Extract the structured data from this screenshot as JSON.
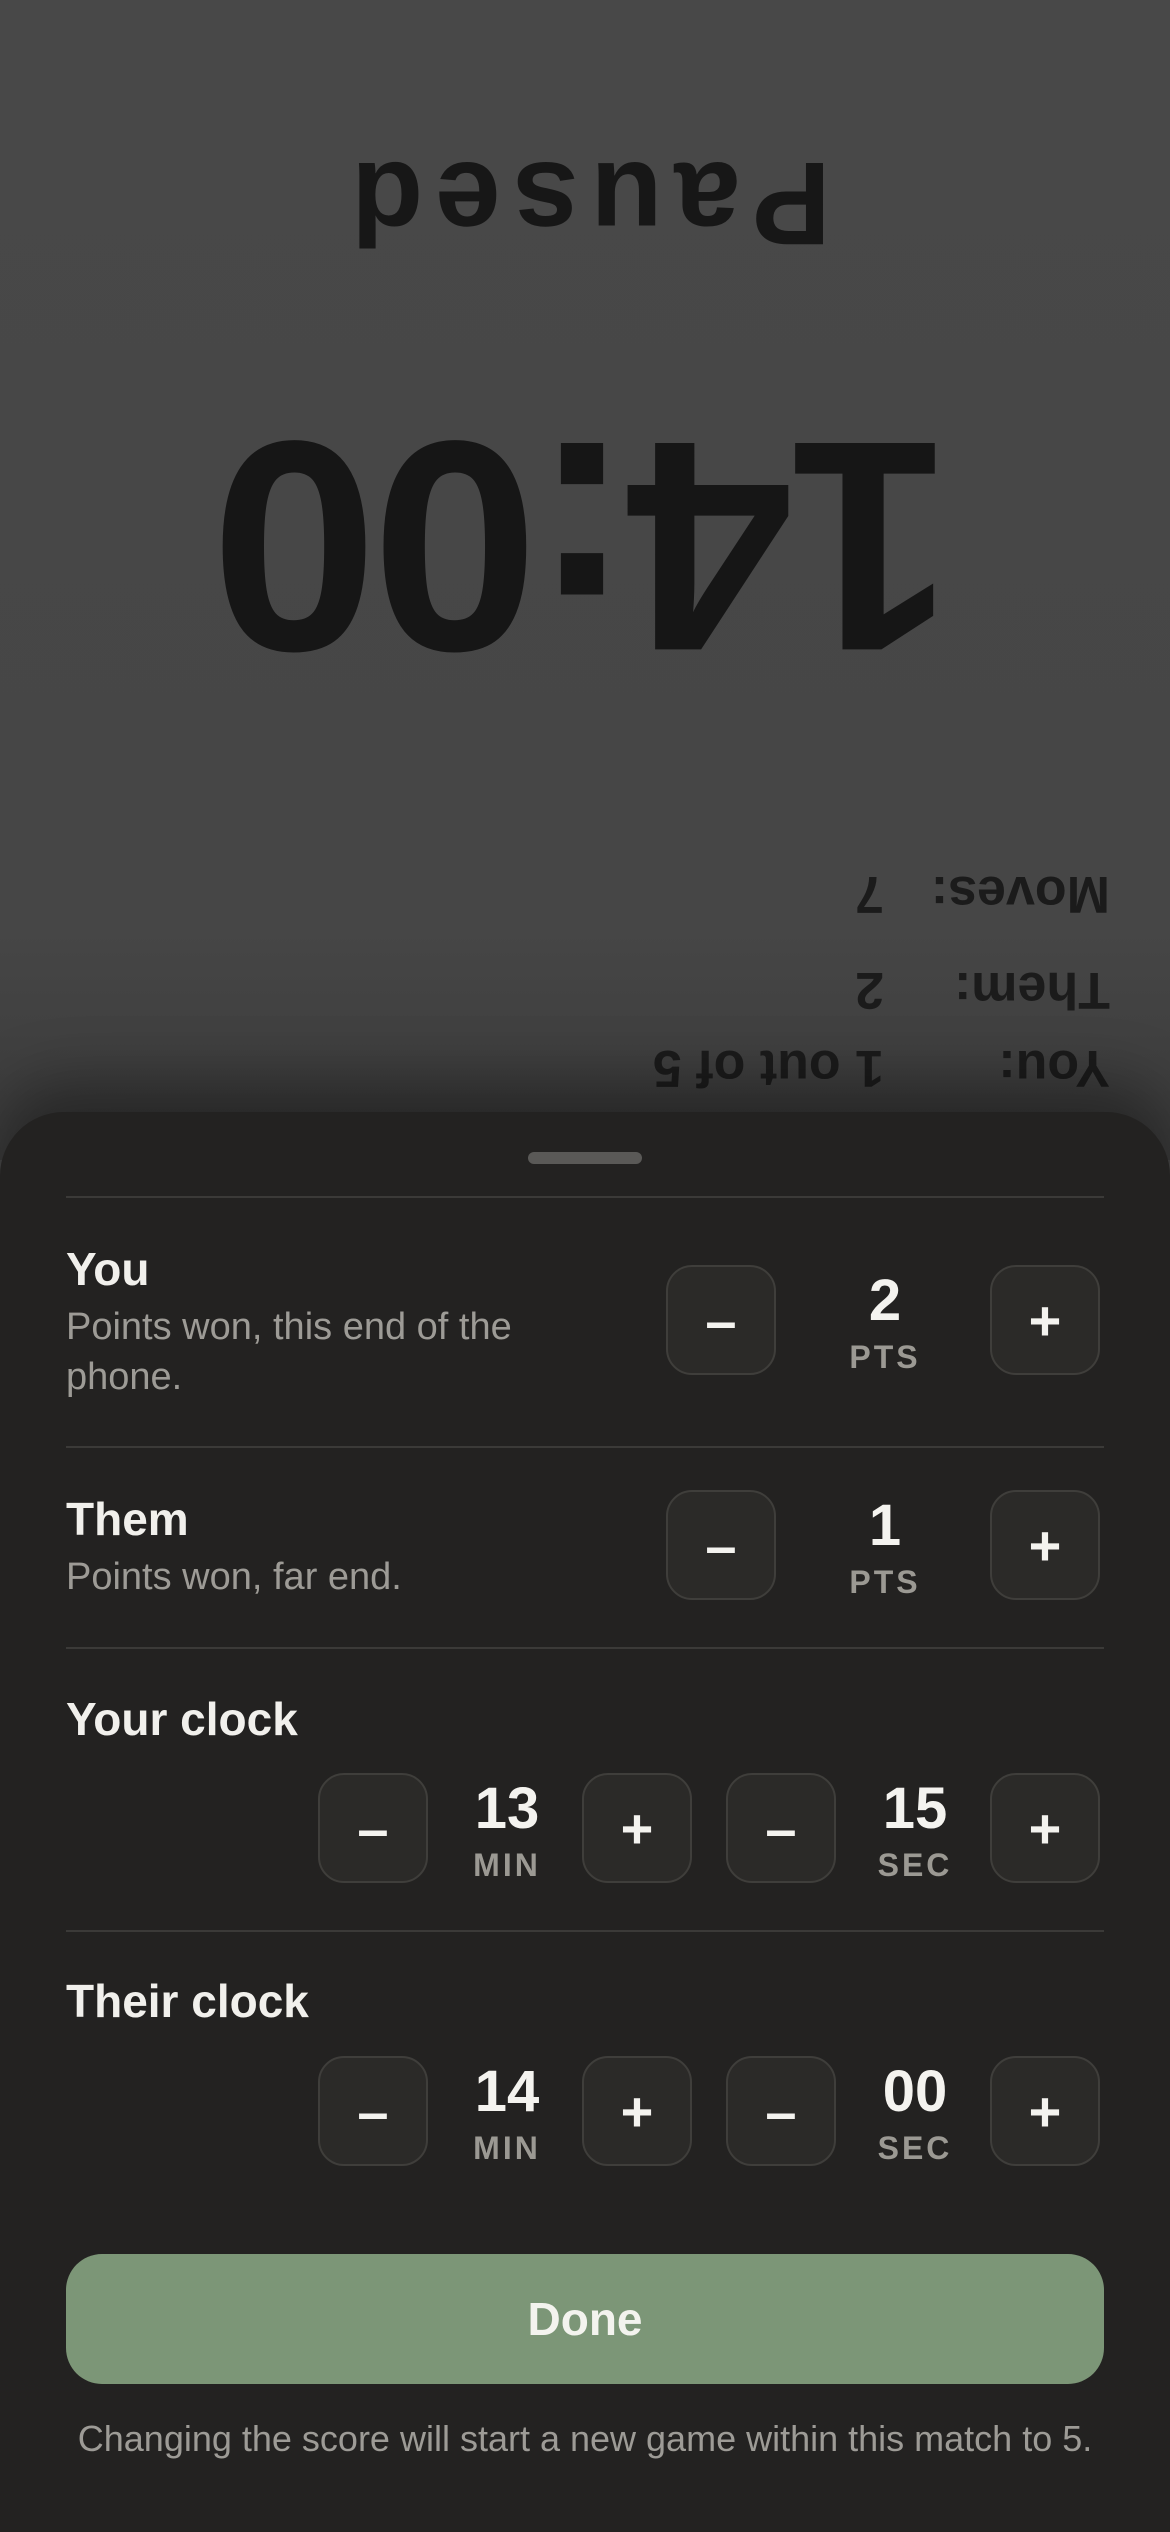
{
  "opponent_view": {
    "status": "Paused",
    "clock": "14:00",
    "stats": [
      {
        "label": "You:",
        "value": "1 out of 5"
      },
      {
        "label": "Them:",
        "value": "2"
      },
      {
        "label": "Moves:",
        "value": "7"
      }
    ]
  },
  "sheet": {
    "you": {
      "title": "You",
      "subtitle": "Points won, this end of the phone.",
      "value": "2",
      "unit": "PTS"
    },
    "them": {
      "title": "Them",
      "subtitle": "Points won, far end.",
      "value": "1",
      "unit": "PTS"
    },
    "your_clock": {
      "title": "Your clock",
      "minutes": "13",
      "minutes_unit": "MIN",
      "seconds": "15",
      "seconds_unit": "SEC"
    },
    "their_clock": {
      "title": "Their clock",
      "minutes": "14",
      "minutes_unit": "MIN",
      "seconds": "00",
      "seconds_unit": "SEC"
    },
    "minus_label": "–",
    "plus_label": "+",
    "done_label": "Done",
    "note": "Changing the score will start a new game within this match to 5."
  },
  "colors": {
    "background": "#464646",
    "sheet": "#232221",
    "accent_done": "#7c9677"
  }
}
